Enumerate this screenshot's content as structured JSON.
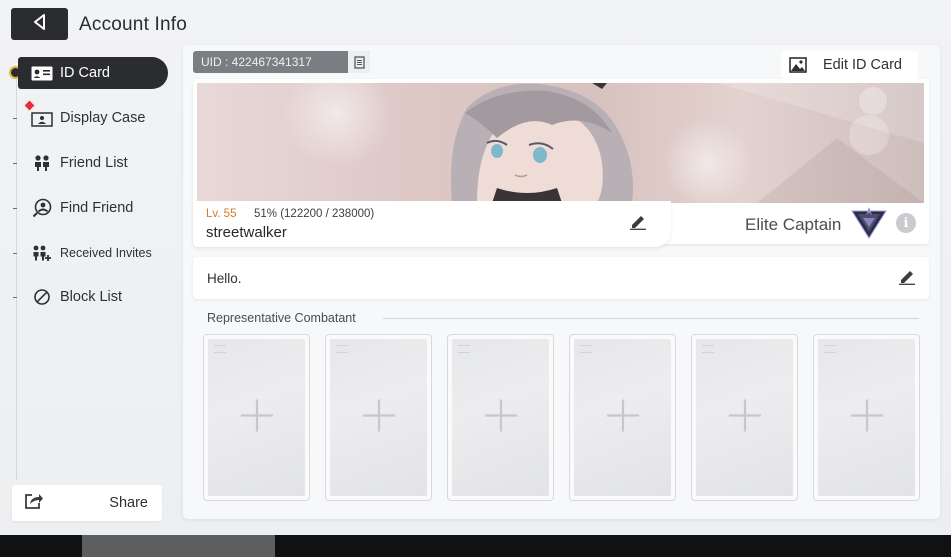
{
  "header": {
    "title": "Account Info",
    "back_icon": "back-arrow-icon"
  },
  "sidebar": {
    "items": [
      {
        "label": "ID Card",
        "icon": "id-card-icon",
        "active": true
      },
      {
        "label": "Display Case",
        "icon": "display-case-icon",
        "badge": "red-diamond"
      },
      {
        "label": "Friend List",
        "icon": "friend-list-icon"
      },
      {
        "label": "Find Friend",
        "icon": "find-friend-icon"
      },
      {
        "label": "Received Invites",
        "icon": "received-invites-icon"
      },
      {
        "label": "Block List",
        "icon": "block-icon"
      }
    ],
    "share": {
      "label": "Share",
      "icon": "share-icon"
    }
  },
  "profile": {
    "uid": "UID : 422467341317",
    "edit_id_card": "Edit ID Card",
    "level": "Lv. 55",
    "exp_text": "51% (122200 / 238000)",
    "exp_fraction": 0.51,
    "username": "streetwalker",
    "rank": "Elite Captain",
    "greeting": "Hello."
  },
  "combatants": {
    "label": "Representative Combatant",
    "slots": [
      "empty",
      "empty",
      "empty",
      "empty",
      "empty",
      "empty"
    ]
  },
  "colors": {
    "accent_dark": "#2b2c30",
    "level_orange": "#d27c2e",
    "badge_red": "#e0303a",
    "active_ring": "#e0b83a"
  }
}
